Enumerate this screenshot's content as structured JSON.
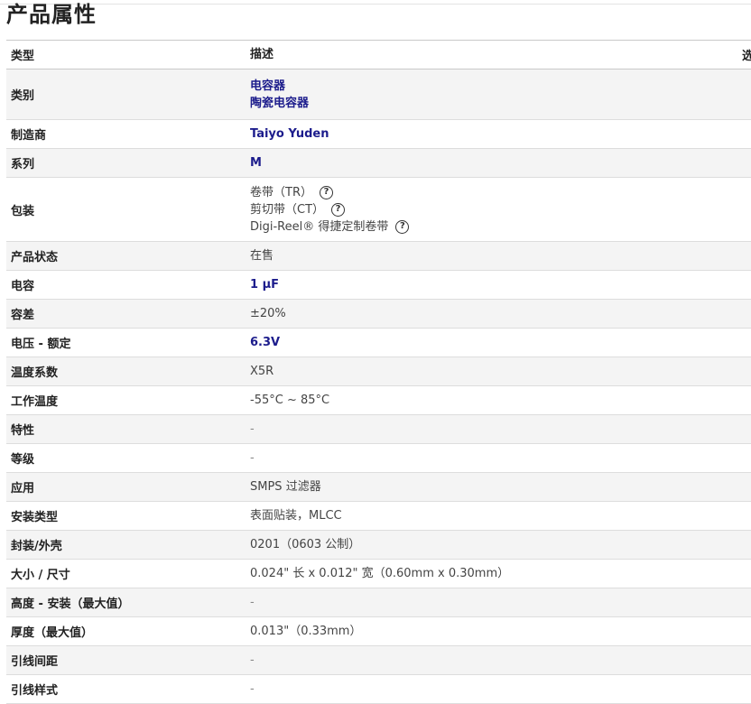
{
  "page_title": "产品属性",
  "table": {
    "header": {
      "type": "类型",
      "description": "描述",
      "select": "选"
    },
    "rows": {
      "category": {
        "label": "类别",
        "values": [
          "电容器",
          "陶瓷电容器"
        ]
      },
      "manufacturer": {
        "label": "制造商",
        "value": "Taiyo Yuden"
      },
      "series": {
        "label": "系列",
        "value": "M"
      },
      "packaging": {
        "label": "包装",
        "options": [
          "卷带（TR）",
          "剪切带（CT）",
          "Digi-Reel® 得捷定制卷带"
        ]
      },
      "product_status": {
        "label": "产品状态",
        "value": "在售"
      },
      "capacitance": {
        "label": "电容",
        "value": "1 µF"
      },
      "tolerance": {
        "label": "容差",
        "value": "±20%"
      },
      "voltage_rated": {
        "label": "电压 - 额定",
        "value": "6.3V"
      },
      "temp_coefficient": {
        "label": "温度系数",
        "value": "X5R"
      },
      "operating_temp": {
        "label": "工作温度",
        "value": "-55°C ~ 85°C"
      },
      "features": {
        "label": "特性",
        "value": "-"
      },
      "ratings": {
        "label": "等级",
        "value": "-"
      },
      "applications": {
        "label": "应用",
        "value": "SMPS 过滤器"
      },
      "mounting_type": {
        "label": "安装类型",
        "value": "表面贴装，MLCC"
      },
      "package_case": {
        "label": "封装/外壳",
        "value": "0201（0603 公制）"
      },
      "size_dimension": {
        "label": "大小 / 尺寸",
        "value": "0.024\" 长 x 0.012\" 宽（0.60mm x 0.30mm）"
      },
      "height_seated": {
        "label": "高度 - 安装（最大值）",
        "value": "-"
      },
      "thickness": {
        "label": "厚度（最大值）",
        "value": "0.013\"（0.33mm）"
      },
      "lead_spacing": {
        "label": "引线间距",
        "value": "-"
      },
      "lead_style": {
        "label": "引线样式",
        "value": "-"
      }
    }
  },
  "icons": {
    "help": "question-circle-icon"
  },
  "colors": {
    "link": "#1c1c8c",
    "alt_row": "#f4f4f4"
  }
}
